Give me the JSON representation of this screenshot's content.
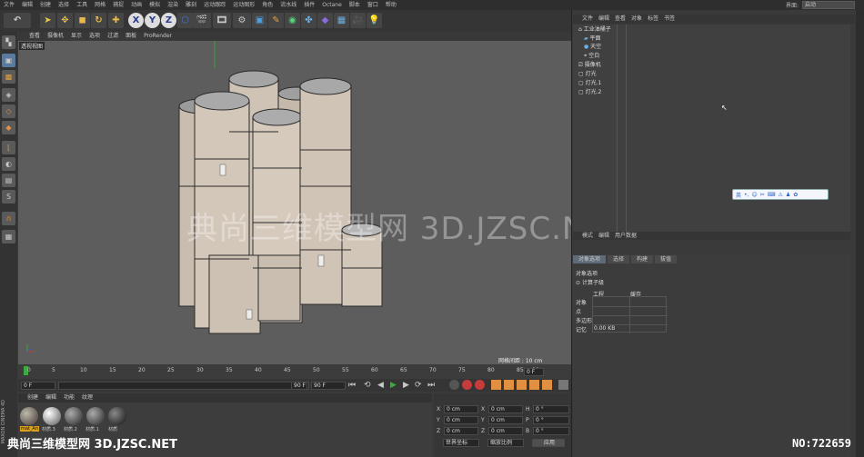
{
  "menu": [
    "文件",
    "编辑",
    "创建",
    "选择",
    "工具",
    "网格",
    "捕捉",
    "动画",
    "模拟",
    "渲染",
    "雕刻",
    "运动跟踪",
    "运动图形",
    "角色",
    "流水线",
    "插件",
    "Octane",
    "脚本",
    "窗口",
    "帮助"
  ],
  "layout": {
    "label": "界面:",
    "value": "启动"
  },
  "toolbar": {
    "x": "X",
    "y": "Y",
    "z": "Z"
  },
  "viewport": {
    "menu": [
      "查看",
      "摄像机",
      "显示",
      "选项",
      "过滤",
      "面板",
      "ProRender"
    ],
    "label": "透视视图",
    "grid_label": "网格间距 : 10 cm"
  },
  "timeline": {
    "ticks": [
      "0",
      "5",
      "10",
      "15",
      "20",
      "25",
      "30",
      "35",
      "40",
      "45",
      "50",
      "55",
      "60",
      "65",
      "70",
      "75",
      "80",
      "85",
      "90"
    ],
    "current_frame": "0 F",
    "start": "0 F",
    "end": "90 F",
    "end2": "90 F"
  },
  "materials": {
    "tabs": [
      "创建",
      "编辑",
      "功能",
      "纹理"
    ],
    "items": [
      "mat_An",
      "材质.3",
      "材质.2",
      "材质.1",
      "材质"
    ]
  },
  "coords": {
    "rows": [
      {
        "a": "X",
        "av": "0 cm",
        "b": "X",
        "bv": "0 cm",
        "c": "H",
        "cv": "0 °"
      },
      {
        "a": "Y",
        "av": "0 cm",
        "b": "Y",
        "bv": "0 cm",
        "c": "P",
        "cv": "0 °"
      },
      {
        "a": "Z",
        "av": "0 cm",
        "b": "Z",
        "bv": "0 cm",
        "c": "B",
        "cv": "0 °"
      }
    ],
    "mode1": "世界坐标",
    "mode2": "缩放比例",
    "apply": "应用"
  },
  "object_manager": {
    "tabs": [
      "文件",
      "编辑",
      "查看",
      "对象",
      "标签",
      "书签"
    ],
    "objects": [
      "工业油桶子",
      "平面",
      "天空",
      "空白",
      "摄像机",
      "灯光",
      "灯光.1",
      "灯光.2"
    ]
  },
  "language_bar": [
    "英",
    "•,",
    "☺",
    "✂",
    "⌨",
    "⚠",
    "♟",
    "✿"
  ],
  "attributes": {
    "menu": [
      "模式",
      "编辑",
      "用户数据"
    ],
    "tabs": [
      "对象选项",
      "选择",
      "构建",
      "拔值"
    ],
    "title": "对象选项",
    "subtitle": "计算子级",
    "col1": "工程",
    "col2": "缓存",
    "rows": [
      "对象",
      "点",
      "多边形",
      "记忆"
    ],
    "memory_value": "0.00 KB"
  },
  "watermark": "典尚三维模型网 3D.JZSC.NET",
  "bottom_watermark": "典尚三维模型网 3D.JZSC.NET",
  "id_label": "NO:722659",
  "brand": "MAXON CINEMA 4D"
}
